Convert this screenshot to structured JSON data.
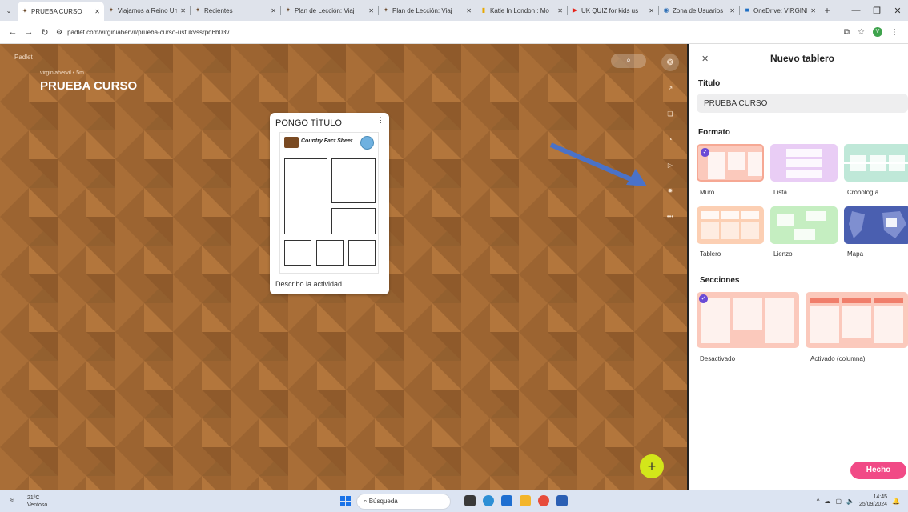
{
  "browser": {
    "tabs": [
      {
        "label": "PRUEBA CURSO",
        "active": true,
        "favicon": "padlet-icon"
      },
      {
        "label": "Viajamos a Reino Un",
        "favicon": "padlet-icon"
      },
      {
        "label": "Recientes",
        "favicon": "padlet-icon"
      },
      {
        "label": "Plan de Lección: Viaj",
        "favicon": "padlet-icon"
      },
      {
        "label": "Plan de Lección: Viaj",
        "favicon": "padlet-icon"
      },
      {
        "label": "Katie In London : Mo",
        "favicon": "bookmark-icon"
      },
      {
        "label": "UK QUIZ for kids us",
        "favicon": "youtube-icon"
      },
      {
        "label": "Zona de Usuarios",
        "favicon": "globe-icon"
      },
      {
        "label": "OneDrive: VIRGINIA",
        "favicon": "onedrive-icon"
      }
    ],
    "url": "padlet.com/virginiahervil/prueba-curso-ustukvssrpq6b03v",
    "profile_initial": "V"
  },
  "board": {
    "brand": "Padlet",
    "author": "virginiahervil • 5m",
    "title": "PRUEBA CURSO",
    "post": {
      "title": "PONGO TÍTULO",
      "worksheet_title": "Country Fact Sheet",
      "description": "Describo la actividad"
    },
    "accent": "#d3e61a",
    "background": "#9c6431"
  },
  "panel": {
    "title": "Nuevo tablero",
    "titulo_label": "Título",
    "titulo_value": "PRUEBA CURSO",
    "formato_label": "Formato",
    "formats": [
      {
        "label": "Muro",
        "selected": true,
        "color": "#fbc9bc"
      },
      {
        "label": "Lista",
        "color": "#e9cdf5"
      },
      {
        "label": "Cronología",
        "color": "#bfe8d8"
      },
      {
        "label": "Tablero",
        "color": "#fccfb3"
      },
      {
        "label": "Lienzo",
        "color": "#c5eec1"
      },
      {
        "label": "Mapa",
        "color": "#4a5fb0"
      }
    ],
    "secciones_label": "Secciones",
    "sections": [
      {
        "label": "Desactivado",
        "selected": true
      },
      {
        "label": "Activado (columna)"
      }
    ],
    "done_label": "Hecho",
    "done_color": "#f14a86"
  },
  "taskbar": {
    "temperature": "21ºC",
    "weather": "Ventoso",
    "search_placeholder": "Búsqueda",
    "time": "14:45",
    "date": "25/09/2024"
  }
}
